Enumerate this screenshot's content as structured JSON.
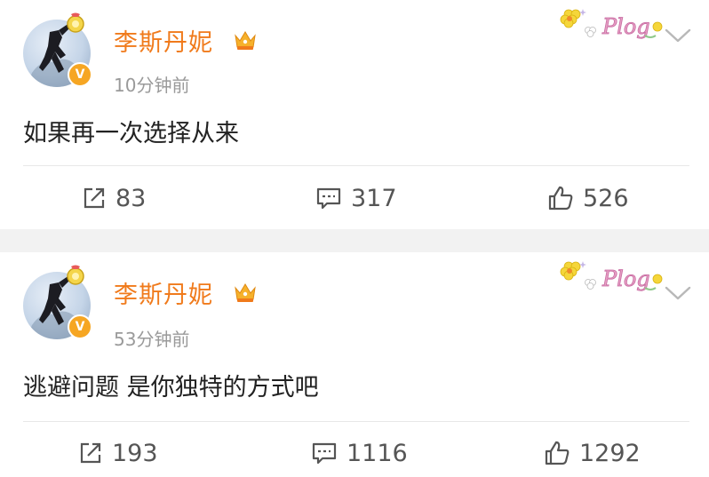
{
  "colors": {
    "username": "#f07a1b",
    "time": "#9a9a9a",
    "separator": "#f2f2f2",
    "vip_badge": "#f6a623"
  },
  "posts": [
    {
      "username": "李斯丹妮",
      "time": "10分钟前",
      "content": "如果再一次选择从来",
      "reposts": "83",
      "comments": "317",
      "likes": "526"
    },
    {
      "username": "李斯丹妮",
      "time": "53分钟前",
      "content": "逃避问题 是你独特的方式吧",
      "reposts": "193",
      "comments": "1116",
      "likes": "1292"
    }
  ],
  "decorations": {
    "plog_label": "Plog",
    "verified_mark": "V"
  }
}
